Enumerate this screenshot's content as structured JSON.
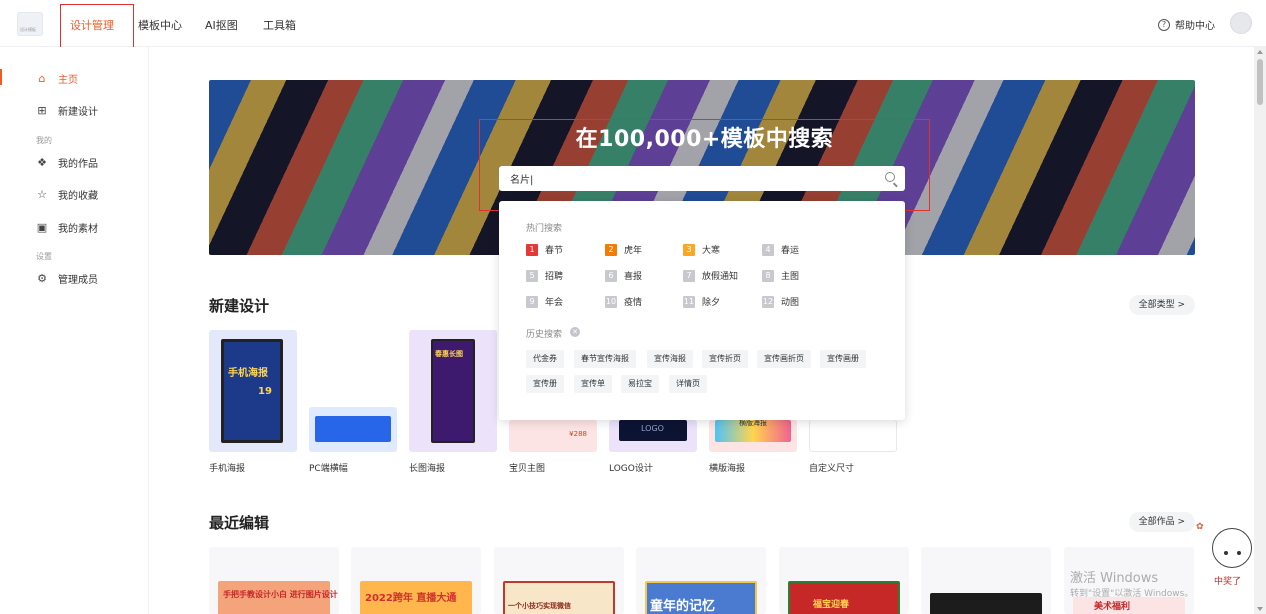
{
  "topbar": {
    "logo_text": "设计模板",
    "nav": [
      "设计管理",
      "模板中心",
      "AI抠图",
      "工具箱"
    ],
    "help_label": "帮助中心"
  },
  "sidebar": {
    "home": "主页",
    "new_design": "新建设计",
    "group_mine": "我的",
    "my_works": "我的作品",
    "my_favorites": "我的收藏",
    "my_materials": "我的素材",
    "group_settings": "设置",
    "manage_members": "管理成员"
  },
  "banner": {
    "title": "在100,000+模板中搜索",
    "search_value": "名片|"
  },
  "dropdown": {
    "hot_label": "热门搜索",
    "hot": [
      {
        "rank": "1",
        "text": "春节",
        "color": "#e53935"
      },
      {
        "rank": "2",
        "text": "虎年",
        "color": "#f57c00"
      },
      {
        "rank": "3",
        "text": "大寒",
        "color": "#f9a825"
      },
      {
        "rank": "4",
        "text": "春运",
        "color": "#c7c9ce"
      },
      {
        "rank": "5",
        "text": "招聘",
        "color": "#c7c9ce"
      },
      {
        "rank": "6",
        "text": "喜报",
        "color": "#c7c9ce"
      },
      {
        "rank": "7",
        "text": "放假通知",
        "color": "#c7c9ce"
      },
      {
        "rank": "8",
        "text": "主图",
        "color": "#c7c9ce"
      },
      {
        "rank": "9",
        "text": "年会",
        "color": "#c7c9ce"
      },
      {
        "rank": "10",
        "text": "疫情",
        "color": "#c7c9ce"
      },
      {
        "rank": "11",
        "text": "除夕",
        "color": "#c7c9ce"
      },
      {
        "rank": "12",
        "text": "动图",
        "color": "#c7c9ce"
      }
    ],
    "history_label": "历史搜索",
    "history": [
      "代金券",
      "春节宣传海报",
      "宣传海报",
      "宣传折页",
      "宣传画折页",
      "宣传画册",
      "宣传册",
      "宣传单",
      "易拉宝",
      "详情页"
    ]
  },
  "new_design": {
    "title": "新建设计",
    "more": "全部类型 >",
    "cards": [
      "手机海报",
      "PC端横幅",
      "长图海报",
      "宝贝主图",
      "LOGO设计",
      "横版海报",
      "自定义尺寸"
    ],
    "poster_text": "手机海报",
    "poster_sub": "19",
    "logo_text": "LOGO",
    "price_text": "¥288",
    "long_poster_text": "春惠长图",
    "banner_text": "横版海报"
  },
  "recent": {
    "title": "最近编辑",
    "more": "全部作品 >",
    "items": [
      "手把手教设计小白\n进行图片设计",
      "2022跨年\n直播大通",
      "一个小技巧实现微信",
      "童年的记忆",
      "福宝迎春",
      "",
      "美术福利"
    ]
  },
  "watermark": {
    "line1": "激活 Windows",
    "line2": "转到\"设置\"以激活 Windows。"
  },
  "mascot_text": "中奖了"
}
